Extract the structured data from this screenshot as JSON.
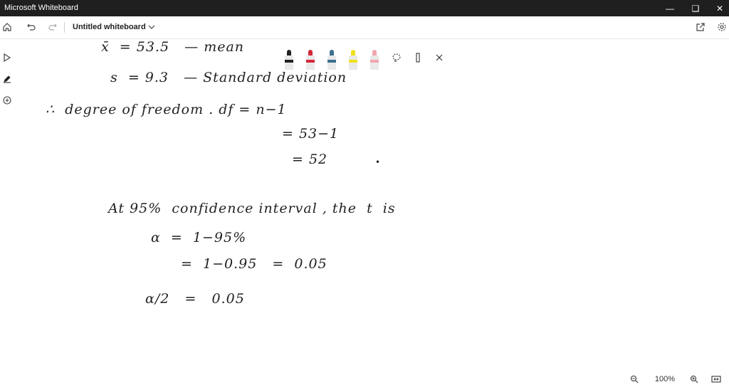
{
  "window": {
    "title": "Microsoft Whiteboard",
    "minimize_icon": "minimize-icon",
    "restore_icon": "restore-icon",
    "close_icon": "close-icon"
  },
  "toolbar": {
    "doc_title": "Untitled whiteboard",
    "icons": [
      "home-icon",
      "undo-icon",
      "redo-icon",
      "chevron-down-icon",
      "share-icon",
      "settings-icon"
    ]
  },
  "left_tools": [
    "select-icon",
    "pen-icon",
    "add-icon"
  ],
  "pen_tray": {
    "pens": [
      {
        "name": "black-pen",
        "color": "#222222"
      },
      {
        "name": "red-pen",
        "color": "#d6283a"
      },
      {
        "name": "blue-pen",
        "color": "#3d6f8f"
      },
      {
        "name": "highlighter-yellow",
        "color": "#f0e21a"
      },
      {
        "name": "eraser",
        "color": "#f2a5b0"
      }
    ],
    "icons": [
      "lasso-icon",
      "ruler-icon",
      "close-icon"
    ]
  },
  "canvas": {
    "lines": [
      "x̄  = 53.5   — mean",
      "s  = 9.3   — Standard deviation",
      "∴  degree of freedom . df = n−1",
      "= 53−1",
      "= 52",
      "At 95%  confidence interval , the  t  is",
      "α  =  1−95%",
      "=  1−0.95   =  0.05",
      "α/2   =   0.05"
    ]
  },
  "zoom": {
    "level": "100%"
  }
}
